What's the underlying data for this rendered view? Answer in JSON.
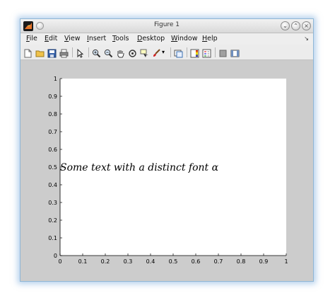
{
  "window": {
    "title": "Figure 1"
  },
  "menu": {
    "items": [
      {
        "mnemonic": "F",
        "rest": "ile"
      },
      {
        "mnemonic": "E",
        "rest": "dit"
      },
      {
        "mnemonic": "V",
        "rest": "iew"
      },
      {
        "mnemonic": "I",
        "rest": "nsert"
      },
      {
        "mnemonic": "T",
        "rest": "ools"
      },
      {
        "mnemonic": "D",
        "rest": "esktop"
      },
      {
        "mnemonic": "W",
        "rest": "indow"
      },
      {
        "mnemonic": "H",
        "rest": "elp"
      }
    ]
  },
  "toolbar": {
    "icons": [
      "new-figure-icon",
      "open-file-icon",
      "save-icon",
      "print-icon",
      "select-arrow-icon",
      "zoom-in-icon",
      "zoom-out-icon",
      "pan-hand-icon",
      "rotate-3d-icon",
      "data-cursor-icon",
      "brush-icon",
      "link-plot-icon",
      "colorbar-icon",
      "legend-icon",
      "hide-plot-tools-icon",
      "show-plot-tools-icon"
    ]
  },
  "axes": {
    "xticks": [
      "0",
      "0.1",
      "0.2",
      "0.3",
      "0.4",
      "0.5",
      "0.6",
      "0.7",
      "0.8",
      "0.9",
      "1"
    ],
    "yticks": [
      "0",
      "0.1",
      "0.2",
      "0.3",
      "0.4",
      "0.5",
      "0.6",
      "0.7",
      "0.8",
      "0.9",
      "1"
    ],
    "xlim": [
      0,
      1
    ],
    "ylim": [
      0,
      1
    ],
    "annotation": {
      "text": "Some text with a distinct font α",
      "x": 0,
      "y": 0.5
    }
  },
  "colors": {
    "figure_bg": "#cccccc",
    "axes_bg": "#ffffff"
  }
}
